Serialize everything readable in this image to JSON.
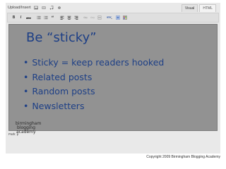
{
  "header": {
    "upload_label": "Upload/Insert",
    "media_icons": [
      "image-icon",
      "video-icon",
      "audio-icon",
      "media-icon"
    ]
  },
  "tabs": [
    {
      "label": "Visual",
      "active": true
    },
    {
      "label": "HTML",
      "active": false
    }
  ],
  "toolbar": {
    "buttons": [
      {
        "name": "bold-button",
        "glyph": "B"
      },
      {
        "name": "italic-button",
        "glyph": "I"
      },
      {
        "name": "strikethrough-button",
        "glyph": "abc"
      },
      {
        "name": "unordered-list-button",
        "icon": "bullet-list-icon"
      },
      {
        "name": "ordered-list-button",
        "icon": "numbered-list-icon"
      },
      {
        "name": "blockquote-button",
        "icon": "quote-icon"
      },
      {
        "name": "align-left-button",
        "icon": "align-left-icon"
      },
      {
        "name": "align-center-button",
        "icon": "align-center-icon"
      },
      {
        "name": "align-right-button",
        "icon": "align-right-icon"
      },
      {
        "name": "insert-link-button",
        "icon": "link-icon"
      },
      {
        "name": "unlink-button",
        "icon": "unlink-icon"
      },
      {
        "name": "more-tag-button",
        "icon": "more-icon"
      },
      {
        "name": "spellcheck-button",
        "icon": "spellcheck-icon"
      },
      {
        "name": "fullscreen-button",
        "icon": "fullscreen-icon"
      },
      {
        "name": "kitchen-sink-button",
        "icon": "kitchen-sink-icon"
      }
    ]
  },
  "content": {
    "title": "Be “sticky”",
    "bullets": [
      "Sticky = keep readers hooked",
      "Related posts",
      "Random posts",
      "Newsletters"
    ],
    "bullet_glyph": "•",
    "logo_lines": [
      "birmingham",
      "blogging",
      "academy"
    ]
  },
  "status": {
    "path": "Path: p"
  },
  "footer": {
    "copyright": "Copyright 2009 Birmingham Blogging Academy"
  },
  "colors": {
    "title": "#1d3f86",
    "content_bg": "#8f8f8f",
    "toolbar_bg": "#dfdfdf"
  }
}
